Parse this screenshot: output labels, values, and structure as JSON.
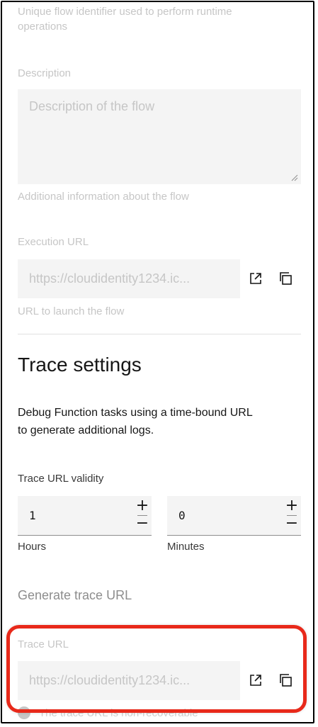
{
  "identifier": {
    "helper_text_line1": "Unique flow identifier used to perform runtime",
    "helper_text_line2": "operations"
  },
  "description": {
    "label": "Description",
    "placeholder": "Description of the flow",
    "helper_text": "Additional information about the flow"
  },
  "execution_url": {
    "label": "Execution URL",
    "value": "https://cloudidentity1234.ic...",
    "helper_text": "URL to launch the flow",
    "open_icon": "launch-icon",
    "copy_icon": "copy-icon"
  },
  "trace_settings": {
    "title": "Trace settings",
    "description_line1": "Debug Function tasks using a time-bound URL",
    "description_line2": "to generate additional logs.",
    "validity_label": "Trace URL validity",
    "hours": {
      "value": "1",
      "label": "Hours",
      "increment": "+",
      "decrement": "−"
    },
    "minutes": {
      "value": "0",
      "label": "Minutes",
      "increment": "+",
      "decrement": "−"
    },
    "generate_label": "Generate trace URL",
    "trace_url": {
      "label": "Trace URL",
      "value": "https://cloudidentity1234.ic...",
      "open_icon": "launch-icon",
      "copy_icon": "copy-icon"
    },
    "notice_text": "The trace URL is non-recoverable"
  },
  "colors": {
    "highlight": "#e8291a",
    "field_bg": "#f4f4f4",
    "disabled_text": "#c6c6c6"
  }
}
